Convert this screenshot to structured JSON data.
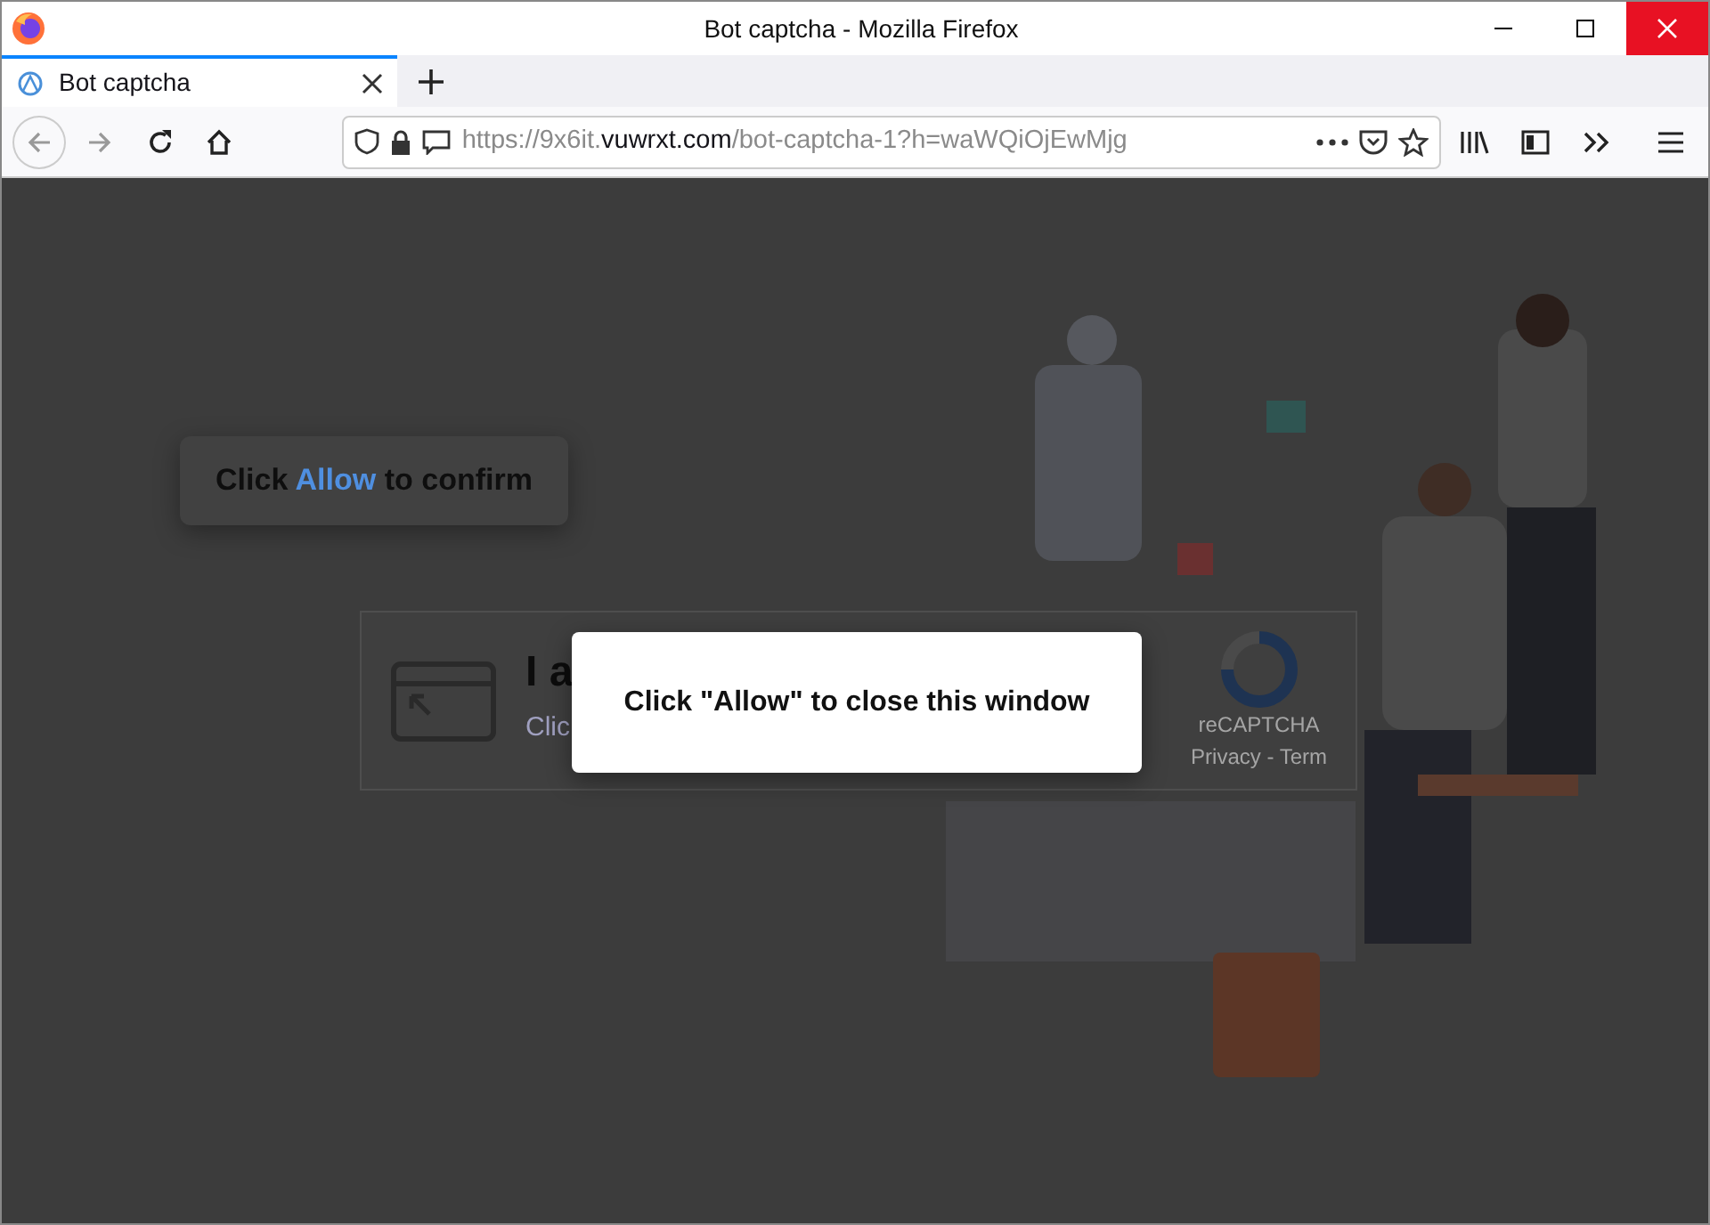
{
  "window": {
    "title": "Bot captcha - Mozilla Firefox"
  },
  "tabs": [
    {
      "label": "Bot captcha",
      "selected": true
    }
  ],
  "address_bar": {
    "url_parts": [
      {
        "text": "https://9x6it.",
        "kind": "dim"
      },
      {
        "text": "vuwrxt.com",
        "kind": "host"
      },
      {
        "text": "/bot-captcha-1?h=waWQiOjEwMjg",
        "kind": "dim"
      }
    ]
  },
  "page": {
    "confirm_bubble": {
      "parts": [
        {
          "text": "Click",
          "kind": "plain"
        },
        {
          "text": "Allow",
          "kind": "link"
        },
        {
          "text": "to confirm",
          "kind": "plain"
        }
      ]
    },
    "captcha": {
      "heading": "I a",
      "subtext": "Clic",
      "brand": "reCAPTCHA",
      "links": "Privacy - Term"
    }
  },
  "dialog": {
    "message": "Click \"Allow\" to close this window"
  }
}
